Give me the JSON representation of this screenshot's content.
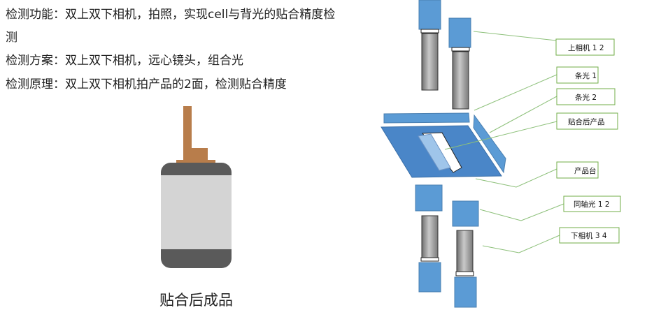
{
  "text": {
    "line1_a": "检测功能：双上双下相机，拍照，实现cell与背光的贴合精度检",
    "line1_b": "测",
    "line2": "检测方案：双上双下相机，远心镜头，组合光",
    "line3": "检测原理：双上双下相机拍产品的2面，检测贴合精度"
  },
  "caption": "贴合后成品",
  "labels": {
    "upper_cam": "上相机 1  2",
    "bar_light_1": "条光 1",
    "bar_light_2": "条光 2",
    "bonded_product": "贴合后产品",
    "product_stage": "产品台",
    "coaxial_light": "同轴光 1  2",
    "lower_cam": "下相机 3  4"
  },
  "colors": {
    "camera_blue": "#5b9bd5",
    "product_blue": "#4a86c8",
    "label_border": "#70ad47",
    "leader_line": "#8dc07a",
    "product_body": "#5a5a5a",
    "product_panel": "#d4d4d4",
    "product_tab": "#b87d4b"
  }
}
